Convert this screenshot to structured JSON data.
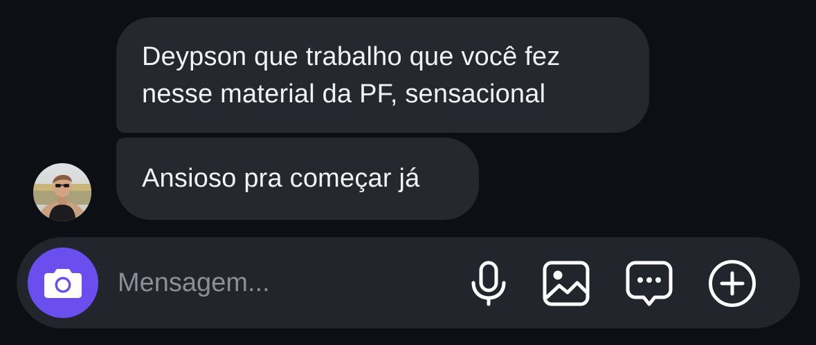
{
  "messages": [
    {
      "lines": [
        "Deypson que trabalho que você fez",
        "nesse material da PF, sensacional"
      ]
    },
    {
      "lines": [
        "Ansioso pra começar já"
      ]
    }
  ],
  "composer": {
    "placeholder": "Mensagem..."
  },
  "icons": {
    "camera": "camera-icon",
    "microphone": "microphone-icon",
    "gallery": "gallery-icon",
    "sticker": "chat-bubble-dots-icon",
    "add": "plus-circle-icon"
  },
  "colors": {
    "background": "#0c0f14",
    "bubble": "#25282e",
    "composer": "#22252b",
    "accent": "#6b4eee"
  }
}
